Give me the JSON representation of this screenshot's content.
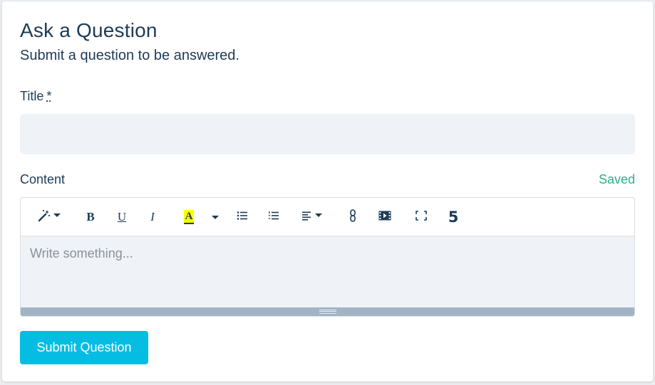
{
  "header": {
    "title": "Ask a Question",
    "subtitle": "Submit a question to be answered."
  },
  "form": {
    "title_label": "Title",
    "required_marker": "*",
    "title_value": "",
    "title_placeholder": "",
    "content_label": "Content",
    "save_status": "Saved",
    "content_placeholder": "Write something...",
    "submit_label": "Submit Question"
  },
  "toolbar": {
    "bold_glyph": "B",
    "underline_glyph": "U",
    "italic_glyph": "I",
    "highlight_glyph": "A",
    "codeview_glyph": "5",
    "items": [
      "magic-style-icon",
      "bold-icon",
      "underline-icon",
      "italic-icon",
      "highlight-color-icon",
      "color-dropdown-icon",
      "unordered-list-icon",
      "ordered-list-icon",
      "align-icon",
      "link-icon",
      "video-icon",
      "fullscreen-icon",
      "html5-icon"
    ]
  },
  "colors": {
    "text": "#1d3b57",
    "accent": "#05bde3",
    "saved": "#2eb08a",
    "input_bg": "#eff3f7",
    "highlight": "#ffff00"
  }
}
